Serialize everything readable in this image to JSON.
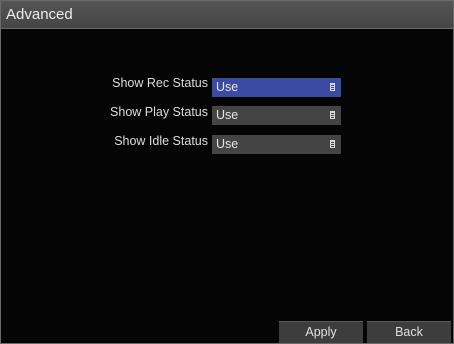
{
  "window": {
    "title": "Advanced"
  },
  "settings": [
    {
      "label": "Show Rec Status",
      "value": "Use",
      "active": true
    },
    {
      "label": "Show Play Status",
      "value": "Use",
      "active": false
    },
    {
      "label": "Show Idle Status",
      "value": "Use",
      "active": false
    }
  ],
  "buttons": {
    "apply_label": "Apply",
    "back_label": "Back"
  },
  "colors": {
    "active_select": "#3b4aa3",
    "inactive_select": "#444444",
    "titlebar": "#4d4d4d",
    "background": "#050505"
  },
  "icons": {
    "dropdown": "list-dropdown-icon"
  }
}
